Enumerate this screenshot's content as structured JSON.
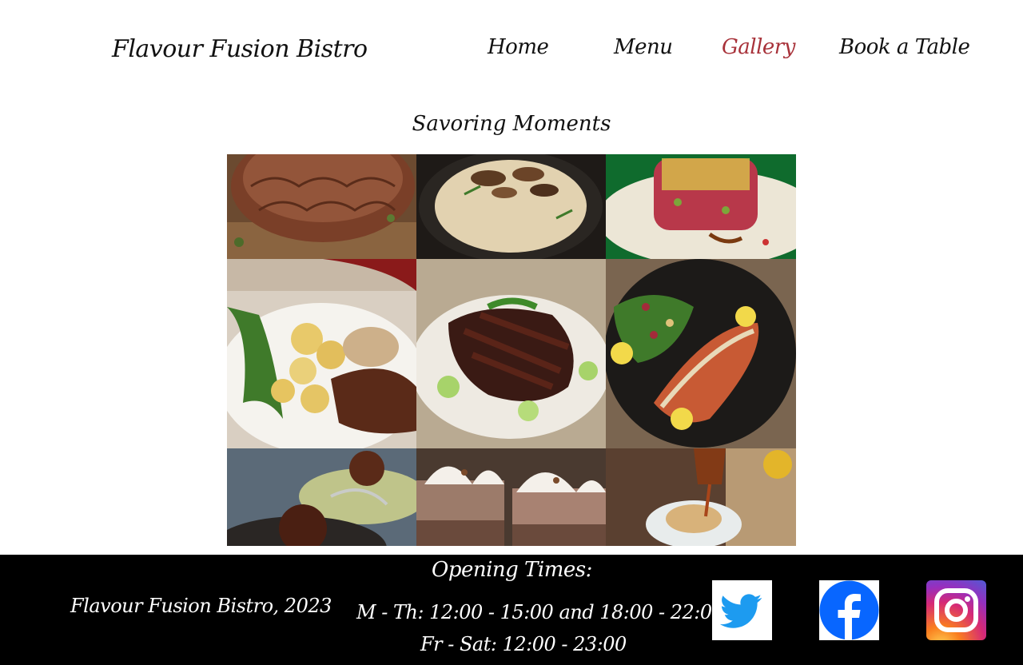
{
  "header": {
    "brand": "Flavour Fusion Bistro",
    "nav": [
      {
        "label": "Home",
        "active": false
      },
      {
        "label": "Menu",
        "active": false
      },
      {
        "label": "Gallery",
        "active": true
      },
      {
        "label": "Book a Table",
        "active": false
      }
    ]
  },
  "gallery": {
    "title": "Savoring Moments",
    "images": [
      {
        "name": "clay-bowl-photo"
      },
      {
        "name": "mushroom-risotto-photo"
      },
      {
        "name": "tuna-tartare-photo"
      },
      {
        "name": "steak-potatoes-photo"
      },
      {
        "name": "glazed-ribs-photo"
      },
      {
        "name": "fish-fillet-salad-photo"
      },
      {
        "name": "chocolate-lava-cake-photo"
      },
      {
        "name": "chocolate-mousse-cups-photo"
      },
      {
        "name": "syrup-dessert-photo"
      }
    ]
  },
  "footer": {
    "copyright": "Flavour Fusion Bistro, 2023",
    "hours_title": "Opening Times:",
    "hours": [
      "M - Th:  12:00 - 15:00 and 18:00 - 22:00",
      "Fr - Sat: 12:00 - 23:00"
    ],
    "social": [
      {
        "icon": "twitter-icon"
      },
      {
        "icon": "facebook-icon"
      },
      {
        "icon": "instagram-icon"
      }
    ]
  },
  "colors": {
    "active_nav": "#a8323a",
    "footer_bg": "#000000",
    "twitter": "#1d9bf0",
    "facebook": "#0866ff"
  }
}
